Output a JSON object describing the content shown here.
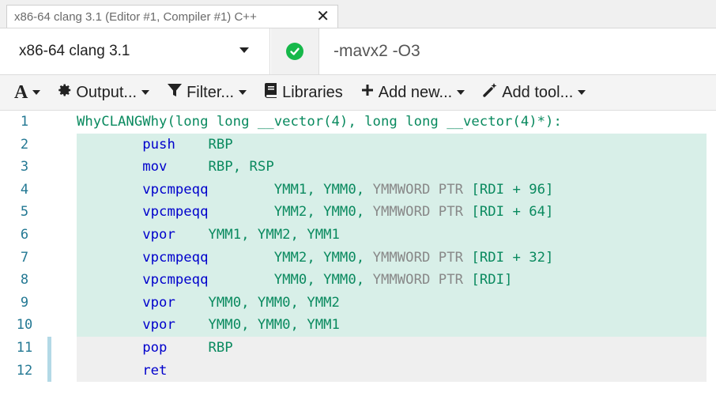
{
  "tab": {
    "title": "x86-64 clang 3.1 (Editor #1, Compiler #1) C++",
    "close_glyph": "✕"
  },
  "compiler": {
    "name": "x86-64 clang 3.1",
    "status": "ok",
    "options": "-mavx2 -O3"
  },
  "toolbar": {
    "font_label": "A",
    "output_label": "Output...",
    "filter_label": "Filter...",
    "libraries_label": "Libraries",
    "add_new_label": "Add new...",
    "add_tool_label": "Add tool..."
  },
  "colors": {
    "highlight_green": "#d8efe8",
    "highlight_grey": "#efefef",
    "ok_green": "#16b84a",
    "instruction": "#0000cc",
    "register": "#0a8a5f"
  },
  "asm": [
    {
      "num": "1",
      "label": "WhyCLANGWhy(long long __vector(4), long long __vector(4)*):"
    },
    {
      "num": "2",
      "instr": "push",
      "ops": "RBP"
    },
    {
      "num": "3",
      "instr": "mov",
      "ops": "RBP, RSP"
    },
    {
      "num": "4",
      "instr": "vpcmpeqq",
      "ops": "YMM1, YMM0, ",
      "ptr": "YMMWORD PTR",
      "mem": "[RDI + 96]"
    },
    {
      "num": "5",
      "instr": "vpcmpeqq",
      "ops": "YMM2, YMM0, ",
      "ptr": "YMMWORD PTR",
      "mem": "[RDI + 64]"
    },
    {
      "num": "6",
      "instr": "vpor",
      "ops": "YMM1, YMM2, YMM1"
    },
    {
      "num": "7",
      "instr": "vpcmpeqq",
      "ops": "YMM2, YMM0, ",
      "ptr": "YMMWORD PTR",
      "mem": "[RDI + 32]"
    },
    {
      "num": "8",
      "instr": "vpcmpeqq",
      "ops": "YMM0, YMM0, ",
      "ptr": "YMMWORD PTR",
      "mem": "[RDI]"
    },
    {
      "num": "9",
      "instr": "vpor",
      "ops": "YMM0, YMM0, YMM2"
    },
    {
      "num": "10",
      "instr": "vpor",
      "ops": "YMM0, YMM0, YMM1"
    },
    {
      "num": "11",
      "instr": "pop",
      "ops": "RBP"
    },
    {
      "num": "12",
      "instr": "ret",
      "ops": ""
    }
  ]
}
